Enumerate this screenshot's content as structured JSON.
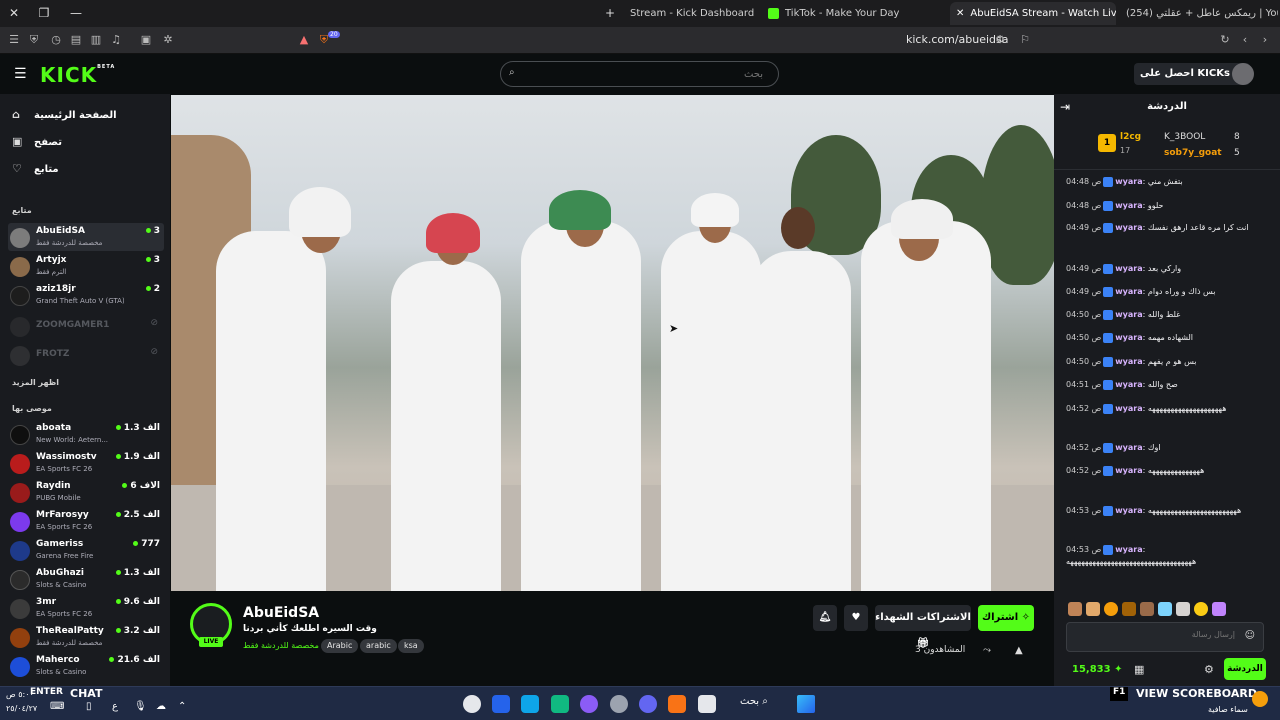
{
  "browser": {
    "tabs": [
      {
        "label": "Stream - Kick Dashboard"
      },
      {
        "label": "TikTok - Make Your Day"
      },
      {
        "label": "AbuEidSA Stream - Watch Live o"
      },
      {
        "label": "(254) ريمكس عاطل + عقلتي | YouTube"
      }
    ],
    "url": "kick.com/abueidsa",
    "shield_count": "20"
  },
  "header": {
    "logo": "KICK",
    "logo_badge": "BETA",
    "search_placeholder": "بحث",
    "get_kicks_label": "احصل على KICKs"
  },
  "sidebar": {
    "nav": [
      {
        "label": "الصفحة الرئيسية",
        "icon": "home-icon"
      },
      {
        "label": "تصفح",
        "icon": "browse-icon"
      },
      {
        "label": "متابع",
        "icon": "heart-icon"
      }
    ],
    "following_header": "متابع",
    "following": [
      {
        "name": "AbuEidSA",
        "sub": "مخصصة للدردشة فقط",
        "viewers": "3",
        "color": "#7c7c7c"
      },
      {
        "name": "Artyjx",
        "sub": "الترم فقط",
        "viewers": "3",
        "color": "#8a6a4a"
      },
      {
        "name": "aziz18jr",
        "sub": "Grand Theft Auto V (GTA)",
        "viewers": "2",
        "color": "#1d1d1d"
      },
      {
        "name": "ZOOMGAMER1",
        "sub": "",
        "viewers": "",
        "color": "#444"
      },
      {
        "name": "FROTZ",
        "sub": "",
        "viewers": "",
        "color": "#555"
      }
    ],
    "show_more": "اظهر المزيد",
    "recommended_header": "موصى بها",
    "recommended": [
      {
        "name": "aboata",
        "sub": "New World: Aetern...",
        "viewers": "1.3 الف",
        "color": "#0f0f0f"
      },
      {
        "name": "Wassimostv",
        "sub": "EA Sports FC 26",
        "viewers": "1.9 الف",
        "color": "#b91c1c"
      },
      {
        "name": "Raydin",
        "sub": "PUBG Mobile",
        "viewers": "6 الاف",
        "color": "#991b1b"
      },
      {
        "name": "MrFarosyy",
        "sub": "EA Sports FC 26",
        "viewers": "2.5 الف",
        "color": "#7c3aed"
      },
      {
        "name": "Gameriss",
        "sub": "Garena Free Fire",
        "viewers": "777",
        "color": "#1e3a8a"
      },
      {
        "name": "AbuGhazi",
        "sub": "Slots & Casino",
        "viewers": "1.3 الف",
        "color": "#2b2b2b"
      },
      {
        "name": "3mr",
        "sub": "EA Sports FC 26",
        "viewers": "9.6 الف",
        "color": "#3b3b3b"
      },
      {
        "name": "TheRealPatty",
        "sub": "مخصصة للدردشة فقط",
        "viewers": "3.2 الف",
        "color": "#92400e"
      },
      {
        "name": "Maherco",
        "sub": "Slots & Casino",
        "viewers": "21.6 الف",
        "color": "#1d4ed8"
      }
    ]
  },
  "channel": {
    "name": "AbuEidSA",
    "live": "LIVE",
    "title": "وقت السيره اطلعك كأني بردنا",
    "category": "مخصصة للدردشة فقط",
    "tags": [
      "Arabic",
      "arabic",
      "ksa"
    ],
    "subscribe_label": "اشتراك",
    "gift_label": "الاشتراكات الشهداء",
    "viewers_label": "المشاهدون 3"
  },
  "chat": {
    "title": "الدردشة",
    "leaderboard": [
      {
        "rank": "1",
        "name": "l2cg",
        "value": "17"
      },
      {
        "name": "K_3BOOL",
        "value": "8"
      },
      {
        "name": "sob7y_goat",
        "value": "5"
      }
    ],
    "messages": [
      {
        "time": "04:48 ص",
        "user": "wyara",
        "text": "بتفش مني"
      },
      {
        "time": "04:48 ص",
        "user": "wyara",
        "text": "حلوو"
      },
      {
        "time": "04:49 ص",
        "user": "wyara",
        "text": "انت كرا مره قاعد ارهق نفسك"
      },
      {
        "time": "04:49 ص",
        "user": "wyara",
        "text": "واركي بعد"
      },
      {
        "time": "04:49 ص",
        "user": "wyara",
        "text": "بس ذاك و وراه دوام"
      },
      {
        "time": "04:50 ص",
        "user": "wyara",
        "text": "غلط والله"
      },
      {
        "time": "04:50 ص",
        "user": "wyara",
        "text": "الشهاده مهمه"
      },
      {
        "time": "04:50 ص",
        "user": "wyara",
        "text": "بس هو م يفهم"
      },
      {
        "time": "04:51 ص",
        "user": "wyara",
        "text": "صح والله"
      },
      {
        "time": "04:52 ص",
        "user": "wyara",
        "text": "ههههههههههههههههههههه"
      },
      {
        "time": "04:52 ص",
        "user": "wyara",
        "text": "اوك"
      },
      {
        "time": "04:52 ص",
        "user": "wyara",
        "text": "ههههههههههههههه"
      },
      {
        "time": "04:53 ص",
        "user": "wyara",
        "text": "ههههههههههههههههههههههههه"
      },
      {
        "time": "04:53 ص",
        "user": "wyara",
        "text": "ههههههههههههههههههههههههههههههههههه"
      }
    ],
    "input_placeholder": "إرسال رسالة",
    "kicks_balance": "15,833",
    "send_label": "الدردشة"
  },
  "taskbar": {
    "search_label": "بحث",
    "left_text_1": "ENTER",
    "left_text_2": "CHAT",
    "right_text": "VIEW SCOREBOARD",
    "f1": "F1",
    "clock_time": "٥:٠٠ ص",
    "clock_date": "٢٥/٠٤/٢٧",
    "weather": "سماء صافية"
  },
  "colors": {
    "accent": "#53fc18",
    "bg": "#0b0e0f",
    "panel": "#191b1f"
  }
}
